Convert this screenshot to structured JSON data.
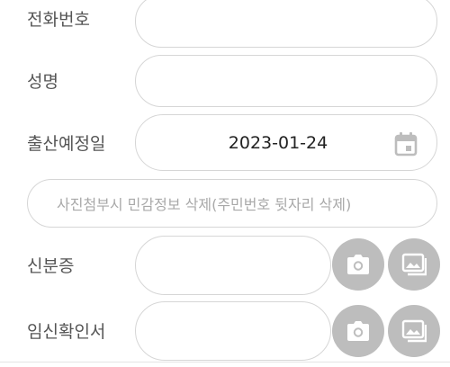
{
  "form": {
    "phone": {
      "label": "전화번호",
      "value": ""
    },
    "name": {
      "label": "성명",
      "value": ""
    },
    "due_date": {
      "label": "출산예정일",
      "value": "2023-01-24",
      "icon": "calendar-icon"
    },
    "photo_notice": "사진첨부시 민감정보 삭제(주민번호 뒷자리 삭제)",
    "id_card": {
      "label": "신분증",
      "camera_icon": "camera-icon",
      "gallery_icon": "image-gallery-icon"
    },
    "pregnancy_cert": {
      "label": "임신확인서",
      "camera_icon": "camera-icon",
      "gallery_icon": "image-gallery-icon"
    }
  },
  "colors": {
    "border": "#d6d6d6",
    "label_text": "#555555",
    "placeholder_text": "#a8a8a8",
    "button_bg": "#bdbdbd",
    "icon_fill": "#ffffff"
  }
}
